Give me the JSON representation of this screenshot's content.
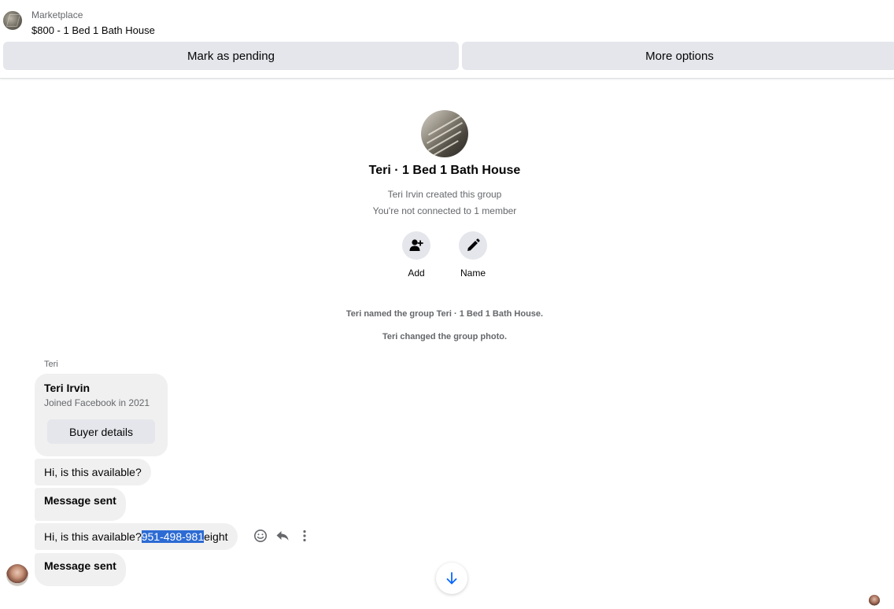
{
  "header": {
    "label": "Marketplace",
    "title": "$800 - 1 Bed 1 Bath House",
    "mark_pending_label": "Mark as pending",
    "more_options_label": "More options"
  },
  "group": {
    "name": "Teri · 1 Bed 1 Bath House",
    "created_text": "Teri Irvin created this group",
    "connection_text": "You're not connected to 1 member",
    "actions": [
      {
        "label": "Add",
        "icon": "add-person-icon"
      },
      {
        "label": "Name",
        "icon": "pencil-icon"
      }
    ]
  },
  "system_messages": [
    "Teri named the group Teri · 1 Bed 1 Bath House.",
    "Teri changed the group photo."
  ],
  "conversation": {
    "sender_name": "Teri",
    "buyer_card": {
      "name": "Teri Irvin",
      "joined": "Joined Facebook in 2021",
      "button_label": "Buyer details"
    },
    "messages": [
      {
        "text": "Hi, is this available?"
      },
      {
        "text": "Message sent"
      },
      {
        "text_before": "Hi, is this available?",
        "text_selected": "951-498-981",
        "text_after": "eight"
      },
      {
        "text": "Message sent"
      }
    ],
    "message_tools": [
      "emoji-icon",
      "reply-icon",
      "more-vertical-icon"
    ]
  },
  "colors": {
    "accent": "#0866ff",
    "selection": "#2c6bd3",
    "bubble": "#f0f0f0",
    "button": "#e4e6eb",
    "secondary_text": "#65676b"
  }
}
